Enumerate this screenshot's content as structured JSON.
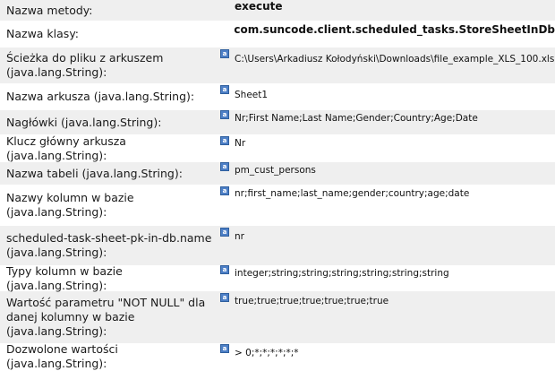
{
  "rows": [
    {
      "label": "Nazwa metody:",
      "value": "execute"
    },
    {
      "label": "Nazwa klasy:",
      "value": "com.suncode.client.scheduled_tasks.StoreSheetInDb"
    },
    {
      "label": "Ścieżka do pliku z arkuszem (java.lang.String):",
      "value": "C:\\Users\\Arkadiusz Kołodyński\\Downloads\\file_example_XLS_100.xls"
    },
    {
      "label": "Nazwa arkusza (java.lang.String):",
      "value": "Sheet1"
    },
    {
      "label": "Nagłówki (java.lang.String):",
      "value": "Nr;First Name;Last Name;Gender;Country;Age;Date"
    },
    {
      "label": "Klucz główny arkusza (java.lang.String):",
      "value": "Nr"
    },
    {
      "label": "Nazwa tabeli (java.lang.String):",
      "value": "pm_cust_persons"
    },
    {
      "label": "Nazwy kolumn w bazie (java.lang.String):",
      "value": "nr;first_name;last_name;gender;country;age;date"
    },
    {
      "label": "scheduled-task-sheet-pk-in-db.name (java.lang.String):",
      "value": "nr"
    },
    {
      "label": "Typy kolumn w bazie (java.lang.String):",
      "value": "integer;string;string;string;string;string;string"
    },
    {
      "label": "Wartość parametru \"NOT NULL\" dla danej kolumny w bazie (java.lang.String):",
      "value": "true;true;true;true;true;true;true"
    },
    {
      "label": "Dozwolone wartości (java.lang.String):",
      "value": "> 0;*;*;*;*;*;*"
    }
  ],
  "field_icon": "text-field-icon",
  "field_icon_glyph": "a"
}
